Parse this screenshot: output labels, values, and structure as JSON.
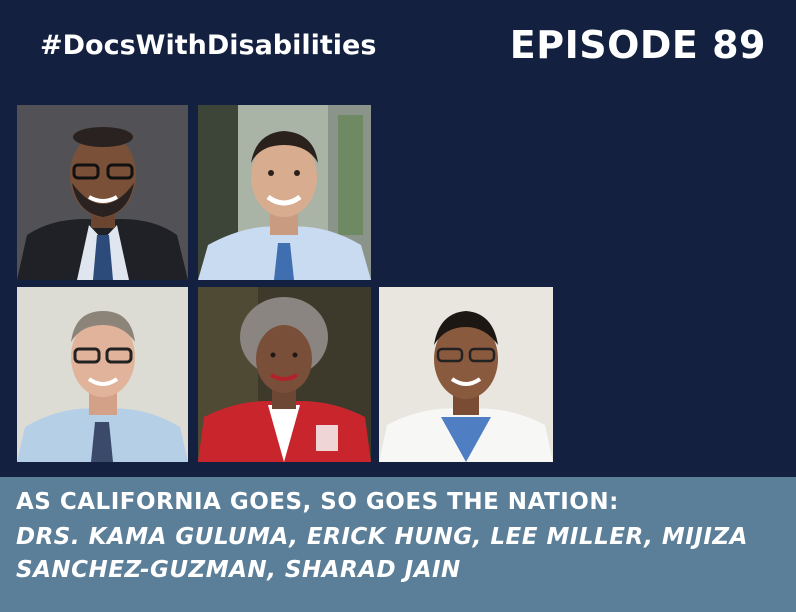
{
  "header": {
    "hashtag": "#DocsWithDisabilities",
    "episode": "EPISODE 89"
  },
  "caption": {
    "line1": "AS CALIFORNIA GOES, SO GOES THE NATION:",
    "line2": "DRS. KAMA GULUMA, ERICK HUNG, LEE MILLER, MIJIZA SANCHEZ-GUZMAN, SHARAD JAIN"
  },
  "colors": {
    "background": "#13203f",
    "caption_band": "#5b7e99",
    "text": "#ffffff"
  }
}
